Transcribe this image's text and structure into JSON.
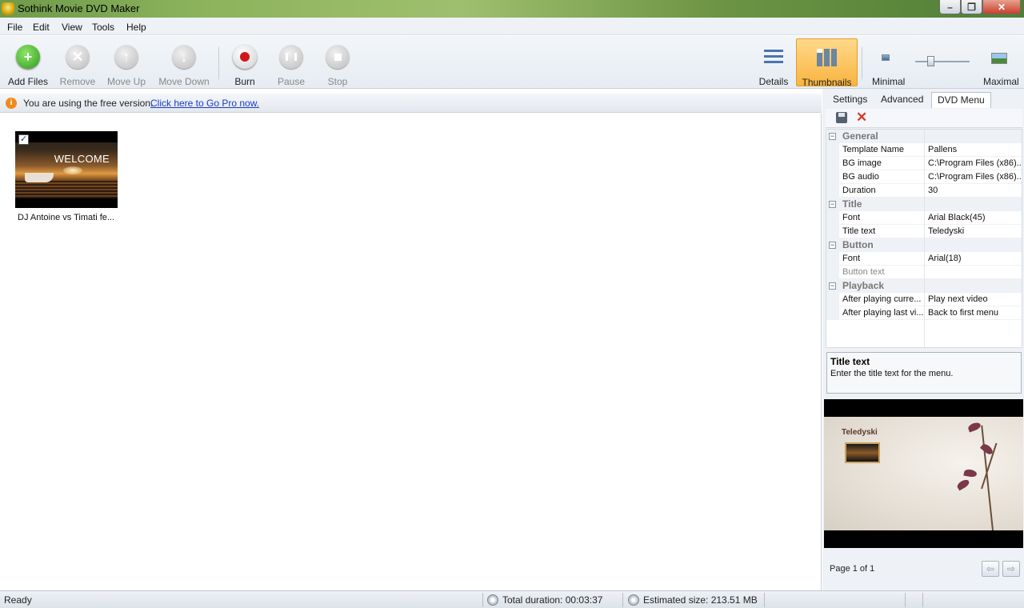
{
  "window": {
    "title": "Sothink Movie DVD Maker",
    "min": "–",
    "max": "❐",
    "close": "✕"
  },
  "menu": [
    "File",
    "Edit",
    "View",
    "Tools",
    "Help"
  ],
  "toolbar": {
    "add_files": "Add Files",
    "remove": "Remove",
    "move_up": "Move Up",
    "move_down": "Move Down",
    "burn": "Burn",
    "pause": "Pause",
    "stop": "Stop",
    "details": "Details",
    "thumbnails": "Thumbnails",
    "minimal": "Minimal",
    "maximal": "Maximal",
    "thumb_size_level": 0.25
  },
  "infobar": {
    "text": "You are using the free version.",
    "link": "Click here to Go Pro now."
  },
  "files": [
    {
      "title_overlay": "WELCOME",
      "label": "DJ Antoine vs Timati fe...",
      "checked": "✓"
    }
  ],
  "panel": {
    "tabs": [
      "Settings",
      "Advanced",
      "DVD Menu"
    ],
    "active_tab": "DVD Menu",
    "properties": {
      "general": {
        "label": "General",
        "template_name_k": "Template Name",
        "template_name_v": "Pallens",
        "bg_image_k": "BG image",
        "bg_image_v": "C:\\Program Files (x86)...",
        "bg_audio_k": "BG audio",
        "bg_audio_v": "C:\\Program Files (x86)...",
        "duration_k": "Duration",
        "duration_v": "30"
      },
      "title": {
        "label": "Title",
        "font_k": "Font",
        "font_v": "Arial Black(45)",
        "text_k": "Title text",
        "text_v": "Teledyski"
      },
      "button": {
        "label": "Button",
        "font_k": "Font",
        "font_v": "Arial(18)",
        "text_k": "Button text",
        "text_v": ""
      },
      "playback": {
        "label": "Playback",
        "after_current_k": "After playing curre...",
        "after_current_v": "Play next video",
        "after_last_k": "After playing last vi...",
        "after_last_v": "Back to first menu"
      }
    },
    "help": {
      "title": "Title text",
      "desc": "Enter the title text for the  menu."
    },
    "preview": {
      "title": "Teledyski"
    },
    "pager": {
      "text": "Page 1 of 1",
      "prev": "⇦",
      "next": "⇨"
    }
  },
  "status": {
    "state": "Ready",
    "duration": "Total duration: 00:03:37",
    "size": "Estimated size: 213.51 MB"
  }
}
